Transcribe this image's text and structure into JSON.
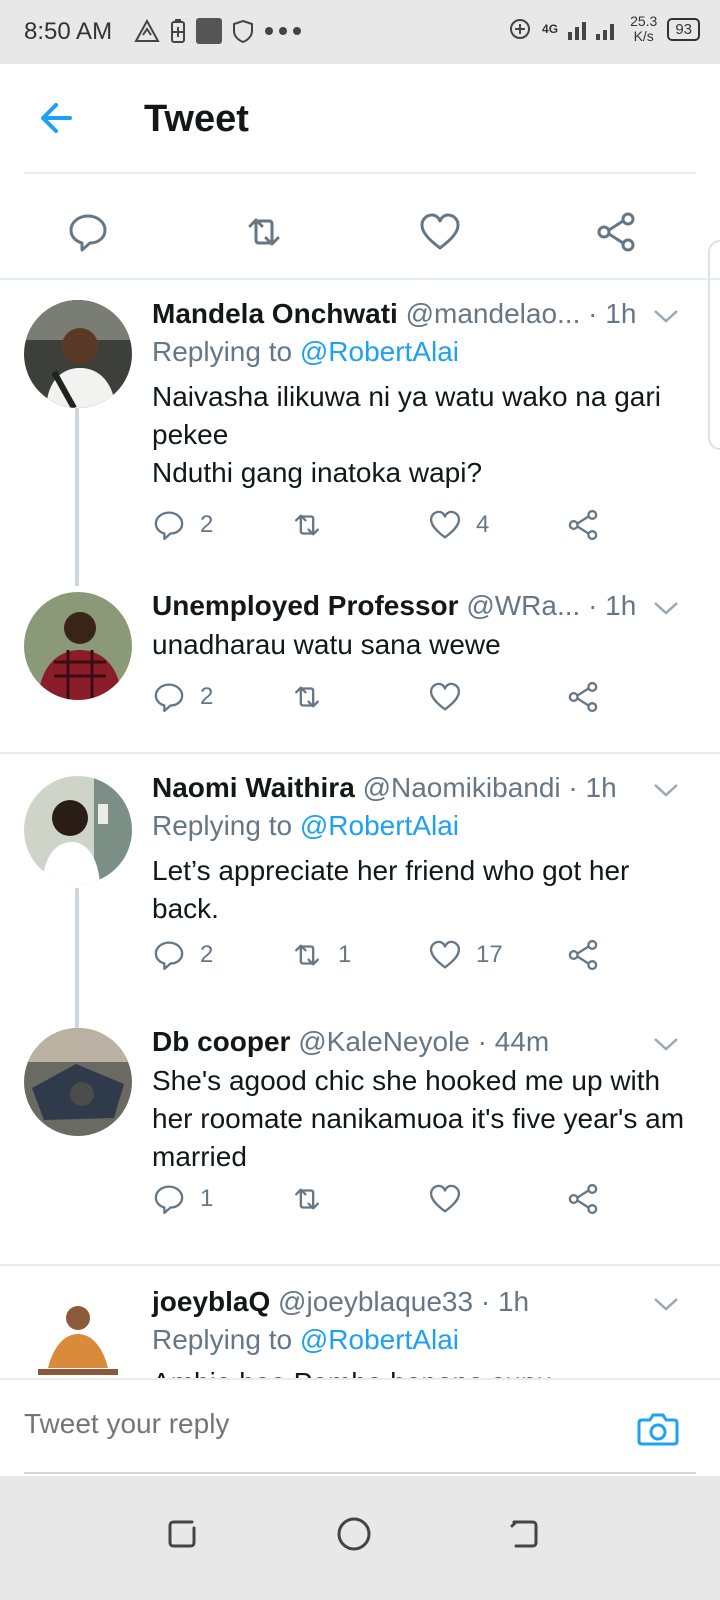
{
  "status_bar": {
    "time": "8:50 AM",
    "network": "4G",
    "speed_value": "25.3",
    "speed_unit": "K/s",
    "battery": "93"
  },
  "header": {
    "title": "Tweet"
  },
  "replies": [
    {
      "name": "Mandela Onchwati",
      "handle": "@mandelao...",
      "time": "· 1h",
      "replying_prefix": "Replying to",
      "replying_to": "@RobertAlai",
      "text": "Naivasha ilikuwa ni ya watu wako na gari pekee\nNduthi gang inatoka wapi?",
      "reply_count": "2",
      "retweet_count": "",
      "like_count": "4"
    },
    {
      "name": "Unemployed Professor",
      "handle": "@WRa...",
      "time": "· 1h",
      "text": "unadharau watu sana wewe",
      "reply_count": "2",
      "retweet_count": "",
      "like_count": ""
    },
    {
      "name": "Naomi Waithira",
      "handle": "@Naomikibandi",
      "time": "· 1h",
      "replying_prefix": "Replying to",
      "replying_to": "@RobertAlai",
      "text": "Let’s appreciate her friend who got her back.",
      "reply_count": "2",
      "retweet_count": "1",
      "like_count": "17"
    },
    {
      "name": "Db cooper",
      "handle": "@KaleNeyole",
      "time": "· 44m",
      "text": "She's agood chic she hooked me up with her roomate nanikamuoa it's five year's am married",
      "reply_count": "1",
      "retweet_count": "",
      "like_count": ""
    },
    {
      "name": "joeyblaQ",
      "handle": "@joeyblaque33",
      "time": "· 1h",
      "replying_prefix": "Replying to",
      "replying_to": "@RobertAlai",
      "text": "Ambia hao,Pombe hapana supu."
    }
  ],
  "composer": {
    "placeholder": "Tweet your reply"
  },
  "colors": {
    "accent": "#1da1f2",
    "secondary_text": "#657786",
    "divider": "#e6ecf0"
  }
}
